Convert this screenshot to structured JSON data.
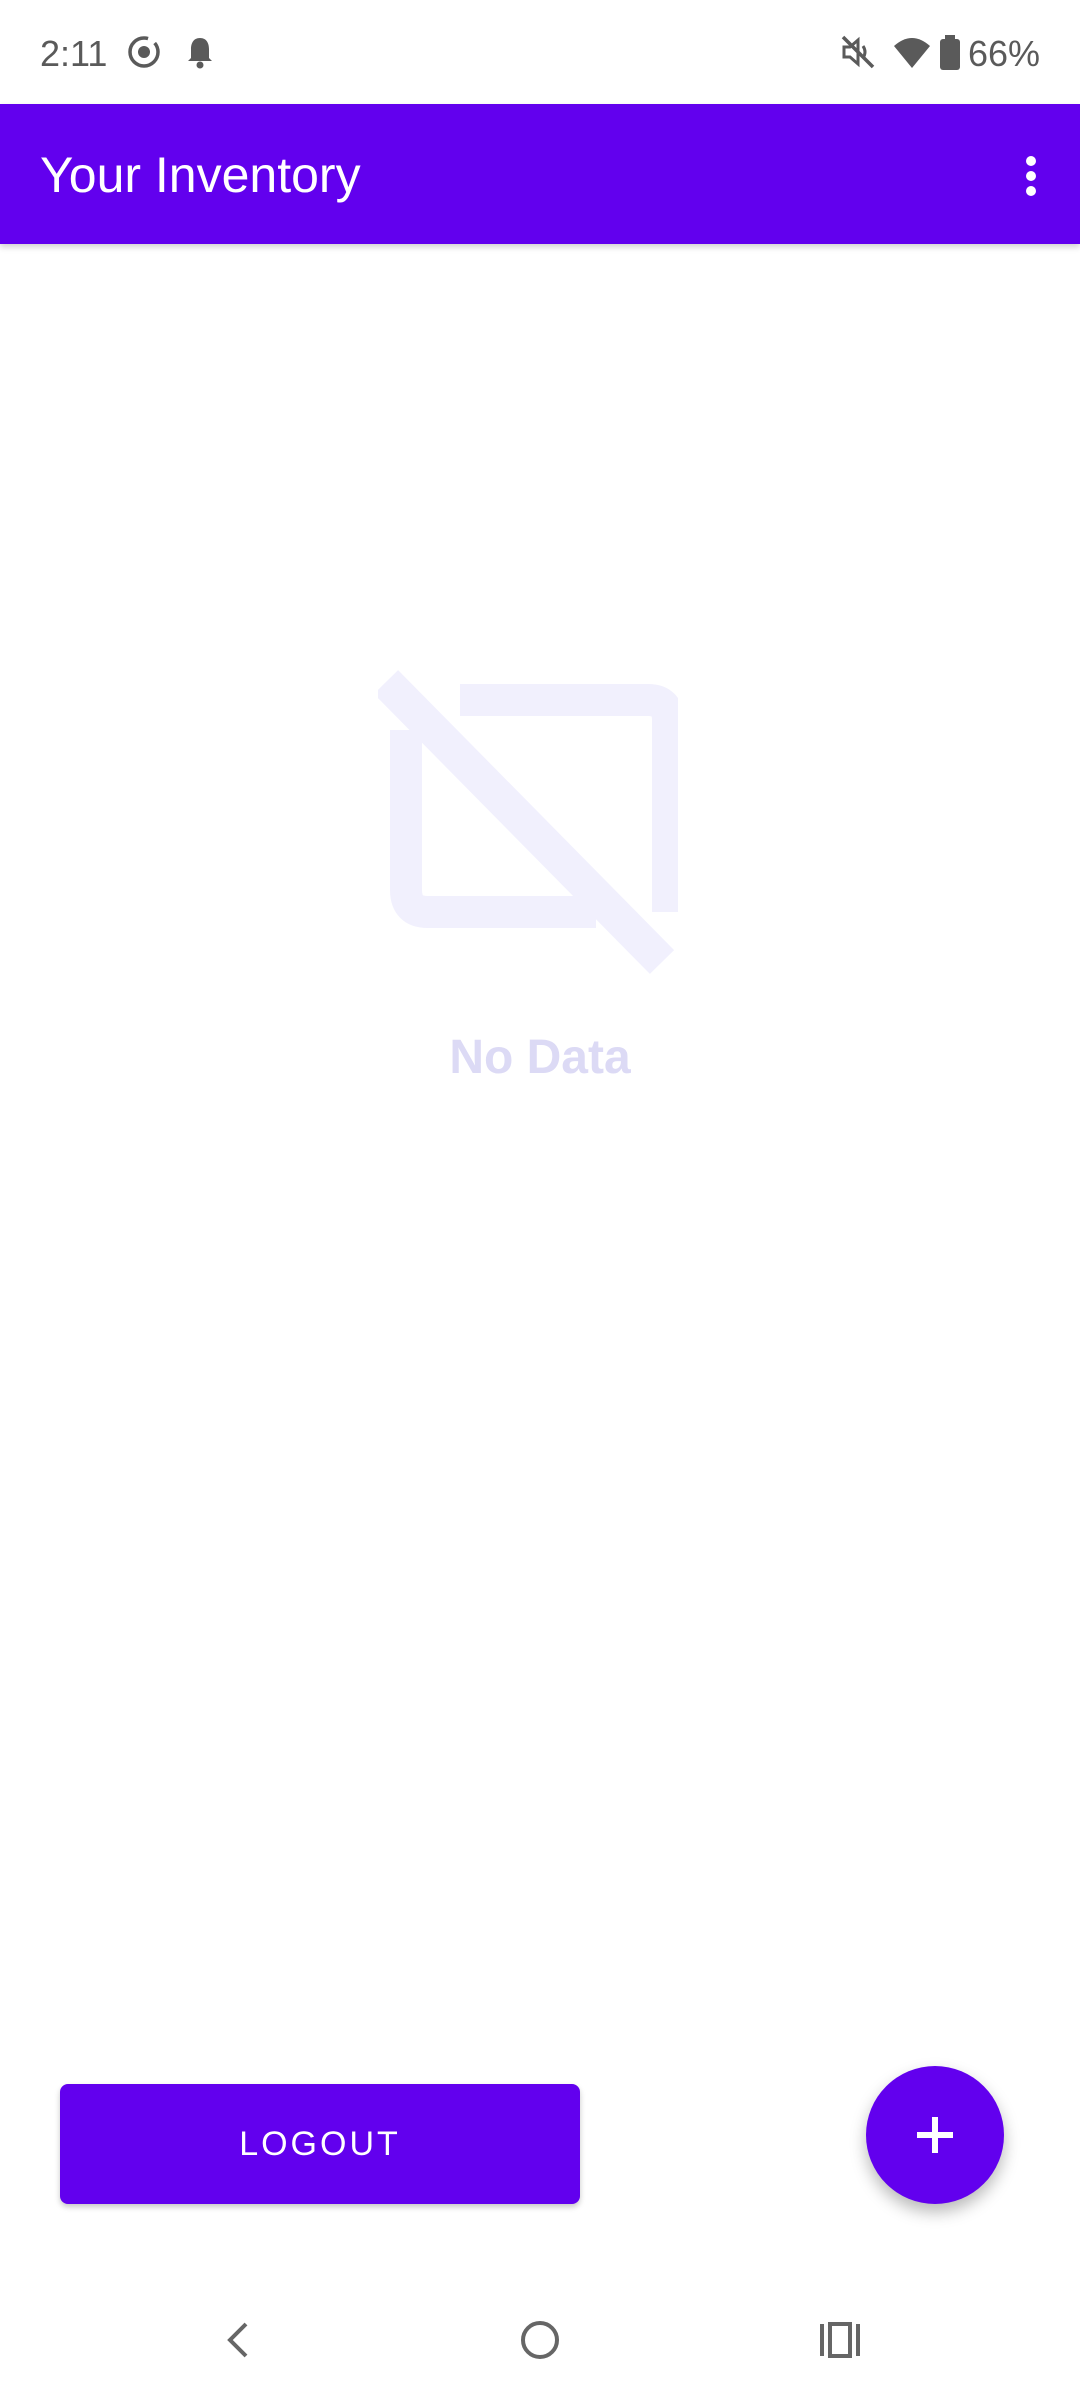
{
  "status_bar": {
    "time": "2:11",
    "battery_percent": "66%",
    "icons": [
      "screen-record-icon",
      "notification-bell-icon",
      "vibrate-mute-icon",
      "wifi-icon",
      "battery-icon"
    ]
  },
  "app_bar": {
    "title": "Your Inventory",
    "menu_icon": "more-vert-icon",
    "color": "#6200ee"
  },
  "empty_state": {
    "icon": "no-image-icon",
    "label": "No Data"
  },
  "actions": {
    "logout_label": "LOGOUT",
    "fab_icon": "add-icon"
  },
  "nav_bar": {
    "buttons": [
      "back-icon",
      "home-icon",
      "recents-icon"
    ]
  }
}
